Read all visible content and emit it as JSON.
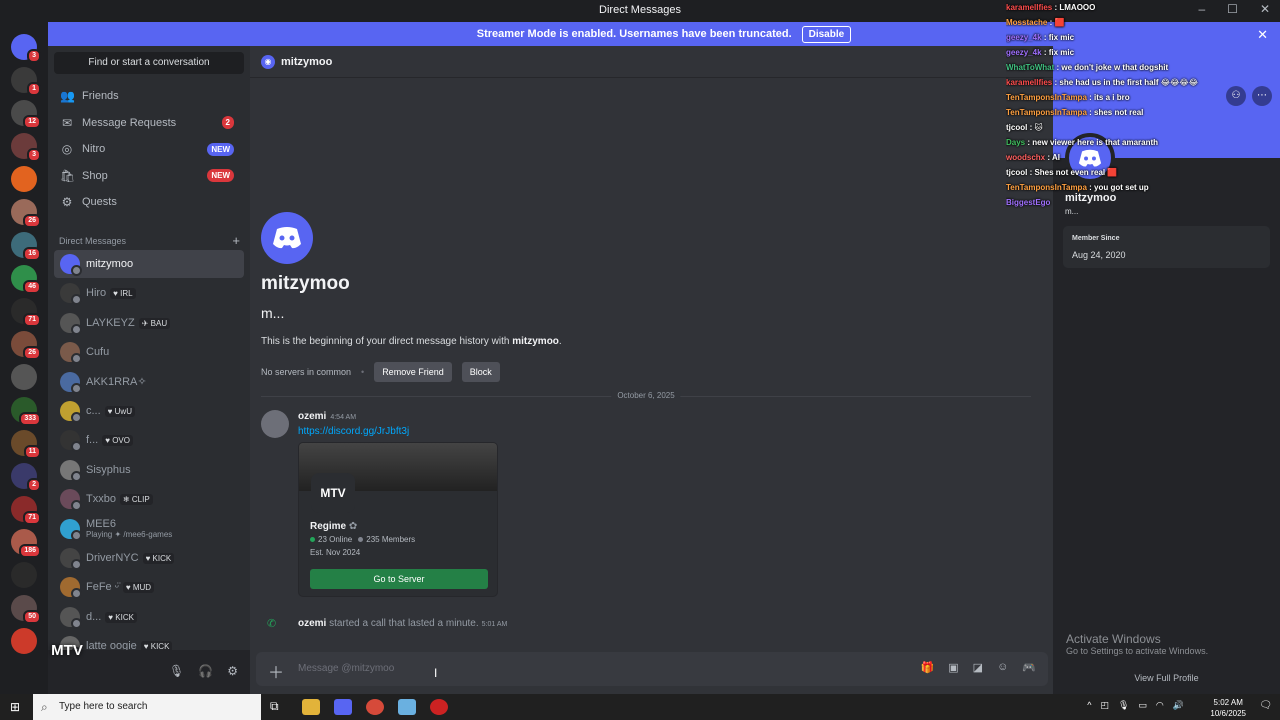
{
  "window": {
    "title": "Direct Messages"
  },
  "banner": {
    "text": "Streamer Mode is enabled. Usernames have been truncated.",
    "disable": "Disable"
  },
  "servers": [
    {
      "badge": "3",
      "color": "#5865f2"
    },
    {
      "badge": "1",
      "color": "#3a3a3a"
    },
    {
      "badge": "12",
      "color": "#4a4a4a"
    },
    {
      "badge": "3",
      "color": "#6b3b3b"
    },
    {
      "badge": "",
      "color": "#e2631f"
    },
    {
      "badge": "26",
      "color": "#9a6a5a"
    },
    {
      "badge": "16",
      "color": "#3d6b7a"
    },
    {
      "badge": "46",
      "color": "#2f8f4a"
    },
    {
      "badge": "71",
      "color": "#2a2a2a"
    },
    {
      "badge": "26",
      "color": "#7a4b3a"
    },
    {
      "badge": "",
      "color": "#555555"
    },
    {
      "badge": "333",
      "color": "#2a5a2a"
    },
    {
      "badge": "11",
      "color": "#6a4a2a"
    },
    {
      "badge": "2",
      "color": "#3a3a6a"
    },
    {
      "badge": "71",
      "color": "#8a2a2a"
    },
    {
      "badge": "186",
      "color": "#aa5a4a"
    },
    {
      "badge": "",
      "color": "#2a2a2a"
    },
    {
      "badge": "50",
      "color": "#5a4a4a"
    },
    {
      "badge": "",
      "color": "#cc3a2a"
    }
  ],
  "dm_sidebar": {
    "search": "Find or start a conversation",
    "nav": [
      {
        "label": "Friends",
        "icon": "👥",
        "tag": "",
        "tag_color": ""
      },
      {
        "label": "Message Requests",
        "icon": "✉",
        "tag": "2",
        "tag_color": "#da373c"
      },
      {
        "label": "Nitro",
        "icon": "◎",
        "tag": "NEW",
        "tag_color": "#5865f2"
      },
      {
        "label": "Shop",
        "icon": "🛍",
        "tag": "NEW",
        "tag_color": "#da373c"
      },
      {
        "label": "Quests",
        "icon": "⚙",
        "tag": "",
        "tag_color": ""
      }
    ],
    "heading": "Direct Messages",
    "dms": [
      {
        "name": "mitzymoo",
        "status": "",
        "sub": "",
        "color": "#5865f2"
      },
      {
        "name": "Hiro",
        "status": "♥ IRL",
        "sub": "",
        "color": "#3a3a3a"
      },
      {
        "name": "LAYKEYZ",
        "status": "✈ BAU",
        "sub": "",
        "color": "#555"
      },
      {
        "name": "Cufu",
        "status": "",
        "sub": "",
        "color": "#7a5a4a"
      },
      {
        "name": "AKK1RRA✧",
        "status": "",
        "sub": "",
        "color": "#4a6aa0"
      },
      {
        "name": "c...",
        "status": "♥ UwU",
        "sub": "",
        "color": "#c0a030"
      },
      {
        "name": "f...",
        "status": "♥ OVO",
        "sub": "",
        "color": "#333"
      },
      {
        "name": "Sisyphus",
        "status": "",
        "sub": "",
        "color": "#777"
      },
      {
        "name": "Txxbo",
        "status": "❄ CLIP",
        "sub": "",
        "color": "#6a4a5a"
      },
      {
        "name": "MEE6",
        "status": "",
        "sub": "Playing ✦ /mee6-games",
        "color": "#30a0d0"
      },
      {
        "name": "DriverNYC",
        "status": "♥ KICK",
        "sub": "",
        "color": "#444"
      },
      {
        "name": "FeFe ᵕ̈",
        "status": "♥ MUD",
        "sub": "",
        "color": "#a06a30"
      },
      {
        "name": "d...",
        "status": "♥ KICK",
        "sub": "",
        "color": "#555"
      },
      {
        "name": "latte oogie",
        "status": "♥ KICK",
        "sub": "",
        "color": "#666"
      }
    ]
  },
  "channel": {
    "name": "mitzymoo",
    "intro_name": "mitzymoo",
    "intro_sub": "m...",
    "intro_text_pre": "This is the beginning of your direct message history with ",
    "intro_text_name": "mitzymoo",
    "intro_text_post": ".",
    "no_servers": "No servers in common",
    "remove_friend": "Remove Friend",
    "block": "Block",
    "date_divider": "October 6, 2025"
  },
  "message": {
    "author": "ozemi",
    "time": "4:54 AM",
    "link": "https://discord.gg/JrJbft3j",
    "invite": {
      "server": "Regime",
      "online": "23 Online",
      "members": "235 Members",
      "est": "Est. Nov 2024",
      "button": "Go to Server",
      "icon_text": "MTV"
    }
  },
  "call": {
    "author": "ozemi",
    "text": "started a call that lasted a minute.",
    "time": "5:01 AM"
  },
  "composer": {
    "placeholder": "Message @mitzymoo"
  },
  "profile": {
    "name": "mitzymoo",
    "sub": "m...",
    "member_since_label": "Member Since",
    "member_since": "Aug 24, 2020",
    "view_full": "View Full Profile"
  },
  "activation": {
    "title": "Activate Windows",
    "sub": "Go to Settings to activate Windows."
  },
  "chat_overlay": [
    {
      "user": "karamellfies",
      "msg": "LMAOOO",
      "color": "#ff4d4d"
    },
    {
      "user": "Mosstache",
      "msg": "🟥",
      "color": "#ffa040"
    },
    {
      "user": "geezy_4k",
      "msg": "fix mic",
      "color": "#a070ff"
    },
    {
      "user": "geezy_4k",
      "msg": "fix mic",
      "color": "#a070ff"
    },
    {
      "user": "WhatToWhat",
      "msg": "we don't joke w that dogshit",
      "color": "#40c080"
    },
    {
      "user": "karamellfies",
      "msg": "she had us in the first half 😂😂😂😂",
      "color": "#ff4d4d"
    },
    {
      "user": "TenTamponsInTampa",
      "msg": "its a i bro",
      "color": "#ffa040"
    },
    {
      "user": "TenTamponsInTampa",
      "msg": "shes not real",
      "color": "#ffa040"
    },
    {
      "user": "tjcool",
      "msg": "🐱",
      "color": "#ffffff"
    },
    {
      "user": "Days",
      "msg": "new viewer here is that amaranth",
      "color": "#40c060"
    },
    {
      "user": "woodschx",
      "msg": "AI",
      "color": "#ff6060"
    },
    {
      "user": "tjcool",
      "msg": "Shes not even real 🟥",
      "color": "#ffffff"
    },
    {
      "user": "TenTamponsInTampa",
      "msg": "you got set up",
      "color": "#ffa040"
    },
    {
      "user": "BiggestEgo",
      "msg": "",
      "color": "#a070ff"
    }
  ],
  "taskbar": {
    "search_placeholder": "Type here to search",
    "time": "5:02 AM",
    "date": "10/6/2025",
    "notif": "3"
  },
  "overlay_logo": "MTV"
}
